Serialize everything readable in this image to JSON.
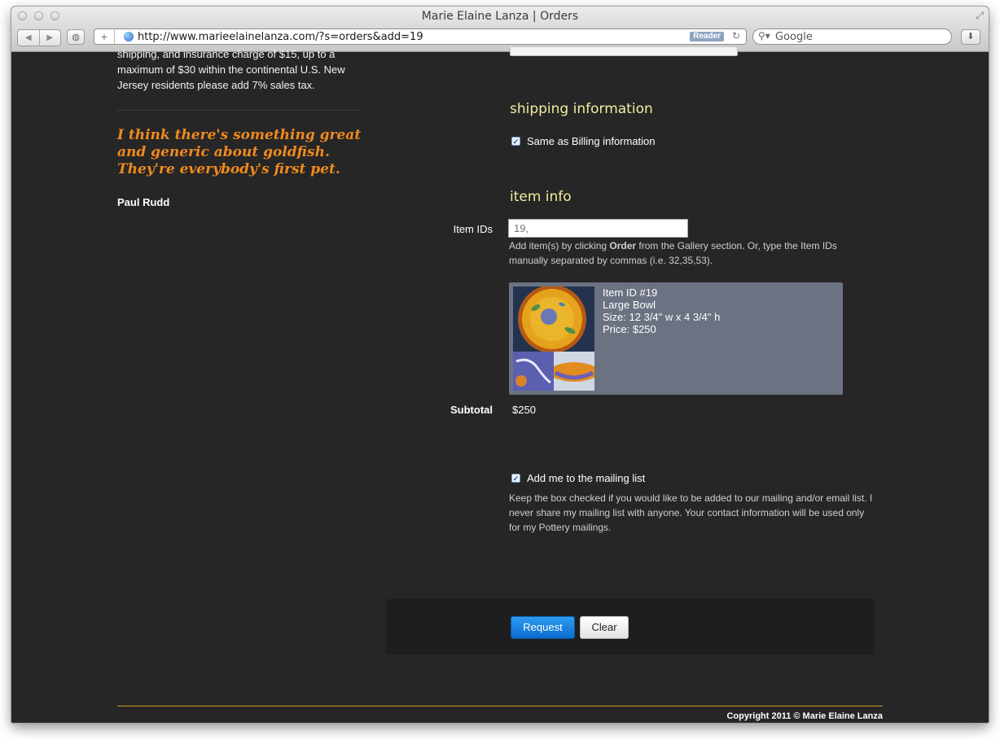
{
  "browser": {
    "window_title": "Marie Elaine Lanza | Orders",
    "url": "http://www.marieelainelanza.com/?s=orders&add=19",
    "reader_label": "Reader",
    "search_placeholder": "Google"
  },
  "sidebar": {
    "shipping_text": "shipping, and insurance charge of $15, up to a maximum of $30 within the continental U.S. New Jersey residents please add 7% sales tax.",
    "quote": "I think there's something great and generic about goldfish. They're everybody's first pet.",
    "quote_author": "Paul Rudd"
  },
  "shipping": {
    "heading": "shipping information",
    "same_as_billing_label": "Same as Billing information",
    "same_as_billing_checked": true
  },
  "item_info": {
    "heading": "item info",
    "item_ids_label": "Item IDs",
    "item_ids_value": "19,",
    "help_pre": "Add item(s) by clicking ",
    "help_bold": "Order",
    "help_post": " from the Gallery section. Or, type the Item IDs manually separated by commas (i.e. 32,35,53).",
    "item": {
      "id_line": "Item ID #19",
      "name": "Large Bowl",
      "size": "Size: 12 3/4\" w x 4 3/4\" h",
      "price": "Price: $250"
    },
    "subtotal_label": "Subtotal",
    "subtotal_value": "$250"
  },
  "mailing": {
    "label": "Add me to the mailing list",
    "checked": true,
    "note": "Keep the box checked if you would like to be added to our mailing and/or email list. I never share my mailing list with anyone. Your contact information will be used only for my Pottery mailings."
  },
  "actions": {
    "request_label": "Request",
    "clear_label": "Clear"
  },
  "footer": {
    "copyright": "Copyright 2011 © Marie Elaine Lanza"
  },
  "colors": {
    "page_bg": "#262626",
    "heading_yellow": "#f4eb9e",
    "quote_orange": "#f08a1e",
    "card_bg": "#6b7282",
    "request_blue": "#0a6bcf",
    "footer_rule": "#d29b2a"
  }
}
